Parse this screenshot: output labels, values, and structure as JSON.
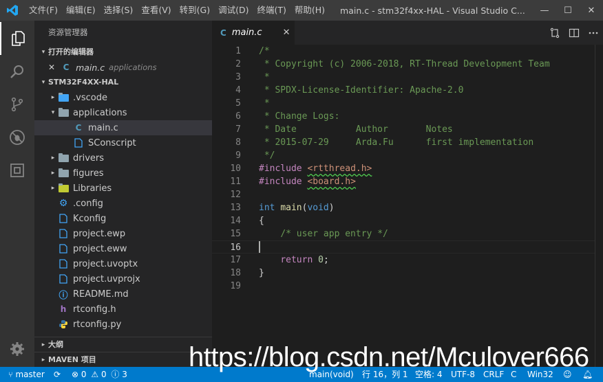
{
  "titlebar": {
    "menus": [
      "文件(F)",
      "编辑(E)",
      "选择(S)",
      "查看(V)",
      "转到(G)",
      "调试(D)",
      "终端(T)",
      "帮助(H)"
    ],
    "window_title": "main.c - stm32f4xx-HAL - Visual Studio C...",
    "minimize": "—",
    "maximize": "☐",
    "close": "✕"
  },
  "sidebar": {
    "title": "资源管理器",
    "open_editors_header": "打开的编辑器",
    "open_editor": {
      "close": "✕",
      "icon": "C",
      "name": "main.c",
      "folder": "applications"
    },
    "project_header": "STM32F4XX-HAL",
    "tree": [
      {
        "name": ".vscode",
        "icon": "vscode-folder-icon",
        "caret": "▸"
      },
      {
        "name": "applications",
        "icon": "folder-icon",
        "caret": "▾"
      },
      {
        "name": "main.c",
        "icon": "C"
      },
      {
        "name": "SConscript",
        "icon": "file-icon"
      },
      {
        "name": "drivers",
        "icon": "folder-icon",
        "caret": "▸"
      },
      {
        "name": "figures",
        "icon": "folder-icon",
        "caret": "▸"
      },
      {
        "name": "Libraries",
        "icon": "libraries-folder-icon",
        "caret": "▸"
      },
      {
        "name": ".config",
        "icon": "gear-icon"
      },
      {
        "name": "Kconfig",
        "icon": "file-icon"
      },
      {
        "name": "project.ewp",
        "icon": "file-icon"
      },
      {
        "name": "project.eww",
        "icon": "file-icon"
      },
      {
        "name": "project.uvoptx",
        "icon": "file-icon"
      },
      {
        "name": "project.uvprojx",
        "icon": "file-icon"
      },
      {
        "name": "README.md",
        "icon": "info-icon"
      },
      {
        "name": "rtconfig.h",
        "icon": "h"
      },
      {
        "name": "rtconfig.py",
        "icon": "python-icon"
      }
    ],
    "outline_header": "大纲",
    "maven_header": "MAVEN 项目"
  },
  "tab": {
    "icon": "C",
    "title": "main.c",
    "close": "✕"
  },
  "editor": {
    "lines": [
      [
        [
          "cmt",
          "/*"
        ]
      ],
      [
        [
          "cmt",
          " * Copyright (c) 2006-2018, RT-Thread Development Team"
        ]
      ],
      [
        [
          "cmt",
          " *"
        ]
      ],
      [
        [
          "cmt",
          " * SPDX-License-Identifier: Apache-2.0"
        ]
      ],
      [
        [
          "cmt",
          " *"
        ]
      ],
      [
        [
          "cmt",
          " * Change Logs:"
        ]
      ],
      [
        [
          "cmt",
          " * Date           Author       Notes"
        ]
      ],
      [
        [
          "cmt",
          " * 2015-07-29     Arda.Fu      first implementation"
        ]
      ],
      [
        [
          "cmt",
          " */"
        ]
      ],
      [
        [
          "pp",
          "#include "
        ],
        [
          "str squig",
          "<rtthread.h>"
        ]
      ],
      [
        [
          "pp",
          "#include "
        ],
        [
          "str squig",
          "<board.h>"
        ]
      ],
      [],
      [
        [
          "kw",
          "int "
        ],
        [
          "fn",
          "main"
        ],
        [
          "plain",
          "("
        ],
        [
          "kw",
          "void"
        ],
        [
          "plain",
          ")"
        ]
      ],
      [
        [
          "plain",
          "{"
        ]
      ],
      [
        [
          "plain",
          "    "
        ],
        [
          "cmt",
          "/* user app entry */"
        ]
      ],
      [],
      [
        [
          "plain",
          "    "
        ],
        [
          "pp",
          "return "
        ],
        [
          "num",
          "0"
        ],
        [
          "plain",
          ";"
        ]
      ],
      [
        [
          "plain",
          "}"
        ]
      ],
      []
    ],
    "current_line": 16
  },
  "statusbar": {
    "branch": "master",
    "errors": "0",
    "warnings": "0",
    "infos": "3",
    "scope": "main(void)",
    "position": "行 16，列 1",
    "spaces": "空格: 4",
    "encoding": "UTF-8",
    "eol": "CRLF",
    "language": "C",
    "platform": "Win32"
  },
  "watermark": "https://blog.csdn.net/Mculover666",
  "colors": {
    "accent": "#007acc",
    "c_icon": "#519aba",
    "comment": "#6a9955"
  }
}
